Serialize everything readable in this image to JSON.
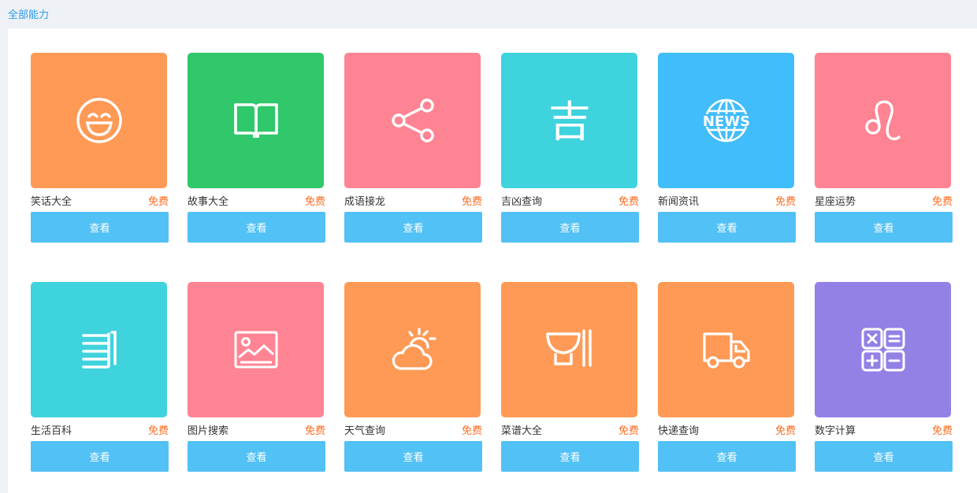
{
  "header": {
    "title": "全部能力"
  },
  "view_label": "查看",
  "price_label": "免费",
  "cards": [
    {
      "name": "笑话大全",
      "color": "#ff9a56",
      "icon": "laugh-face-icon"
    },
    {
      "name": "故事大全",
      "color": "#31c76b",
      "icon": "book-icon"
    },
    {
      "name": "成语接龙",
      "color": "#ff8493",
      "icon": "share-icon"
    },
    {
      "name": "吉凶查询",
      "color": "#3fd3de",
      "icon": "ji-character-icon",
      "icon_text": "吉"
    },
    {
      "name": "新闻资讯",
      "color": "#42bdfb",
      "icon": "news-globe-icon",
      "icon_text": "NEWS"
    },
    {
      "name": "星座运势",
      "color": "#ff8493",
      "icon": "leo-zodiac-icon"
    },
    {
      "name": "生活百科",
      "color": "#3fd3de",
      "icon": "document-icon"
    },
    {
      "name": "图片搜索",
      "color": "#ff8493",
      "icon": "image-icon"
    },
    {
      "name": "天气查询",
      "color": "#ff9a56",
      "icon": "weather-icon"
    },
    {
      "name": "菜谱大全",
      "color": "#ff9a56",
      "icon": "bowl-chopsticks-icon"
    },
    {
      "name": "快递查询",
      "color": "#ff9a56",
      "icon": "truck-icon"
    },
    {
      "name": "数字计算",
      "color": "#9381e6",
      "icon": "calculator-icon"
    }
  ]
}
